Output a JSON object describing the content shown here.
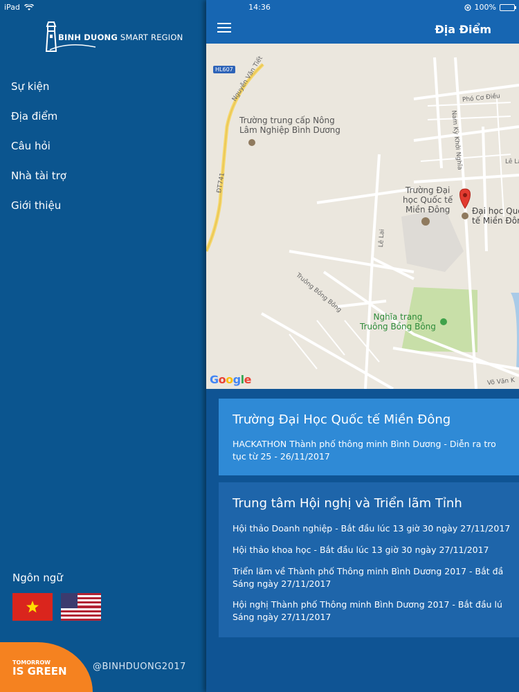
{
  "status": {
    "device": "iPad",
    "time": "14:36",
    "battery": "100%"
  },
  "sidebar": {
    "logo_bold": "BINH DUONG",
    "logo_light": " SMART REGION",
    "items": [
      {
        "label": "Sự kiện"
      },
      {
        "label": "Địa điểm"
      },
      {
        "label": "Câu hỏi"
      },
      {
        "label": "Nhà tài trợ"
      },
      {
        "label": "Giới thiệu"
      }
    ],
    "language_label": "Ngôn ngữ",
    "tomorrow_line1": "TOMORROW",
    "tomorrow_line2": "IS GREEN",
    "handle": "@BINHDUONG2017"
  },
  "header": {
    "title": "Địa Điểm"
  },
  "map": {
    "google": "Google",
    "badge": "HL607",
    "labels": {
      "school_line1": "Trường trung cấp Nông",
      "school_line2": "Lâm Nghiệp Bình Dương",
      "uni_line1": "Trường Đại",
      "uni_line2": "học Quốc tế",
      "uni_line3": "Miền Đông",
      "marker_line1": "Đại học Quố",
      "marker_line2": "tế Miền Đôn",
      "cemetery_line1": "Nghĩa trang",
      "cemetery_line2": "Truông Bồng Bông"
    },
    "roads": {
      "nguyen": "Nguyễn Văn Tiết",
      "dt741": "ĐT741",
      "pho_co_dieu": "Phó Cơ Điều",
      "nam_ky": "Nam Kỳ Khởi Nghĩa",
      "le_lai_1": "Lê Lai",
      "le_lai_2": "Lê Lai",
      "truong_bong_bong": "Truông Bồng Bông",
      "vo_van": "Võ Văn K"
    }
  },
  "cards": [
    {
      "title": "Trường Đại Học Quốc tế Miền Đông",
      "lines": [
        "HACKATHON Thành phố thông minh Bình Dương - Diễn ra tro",
        "tục từ 25 - 26/11/2017"
      ]
    },
    {
      "title": "Trung tâm Hội nghị và Triển lãm Tỉnh",
      "lines": [
        "Hội thảo Doanh nghiệp - Bắt đầu lúc 13 giờ 30 ngày 27/11/2017",
        "Hội thảo khoa học - Bắt đầu lúc 13 giờ 30 ngày 27/11/2017",
        "Triển lãm về Thành phố Thông minh Bình Dương 2017 - Bắt đầ",
        "Sáng ngày 27/11/2017",
        "Hội nghị Thành phố Thông minh Bình Dương 2017 - Bắt đầu lú",
        "Sáng ngày 27/11/2017"
      ]
    }
  ]
}
